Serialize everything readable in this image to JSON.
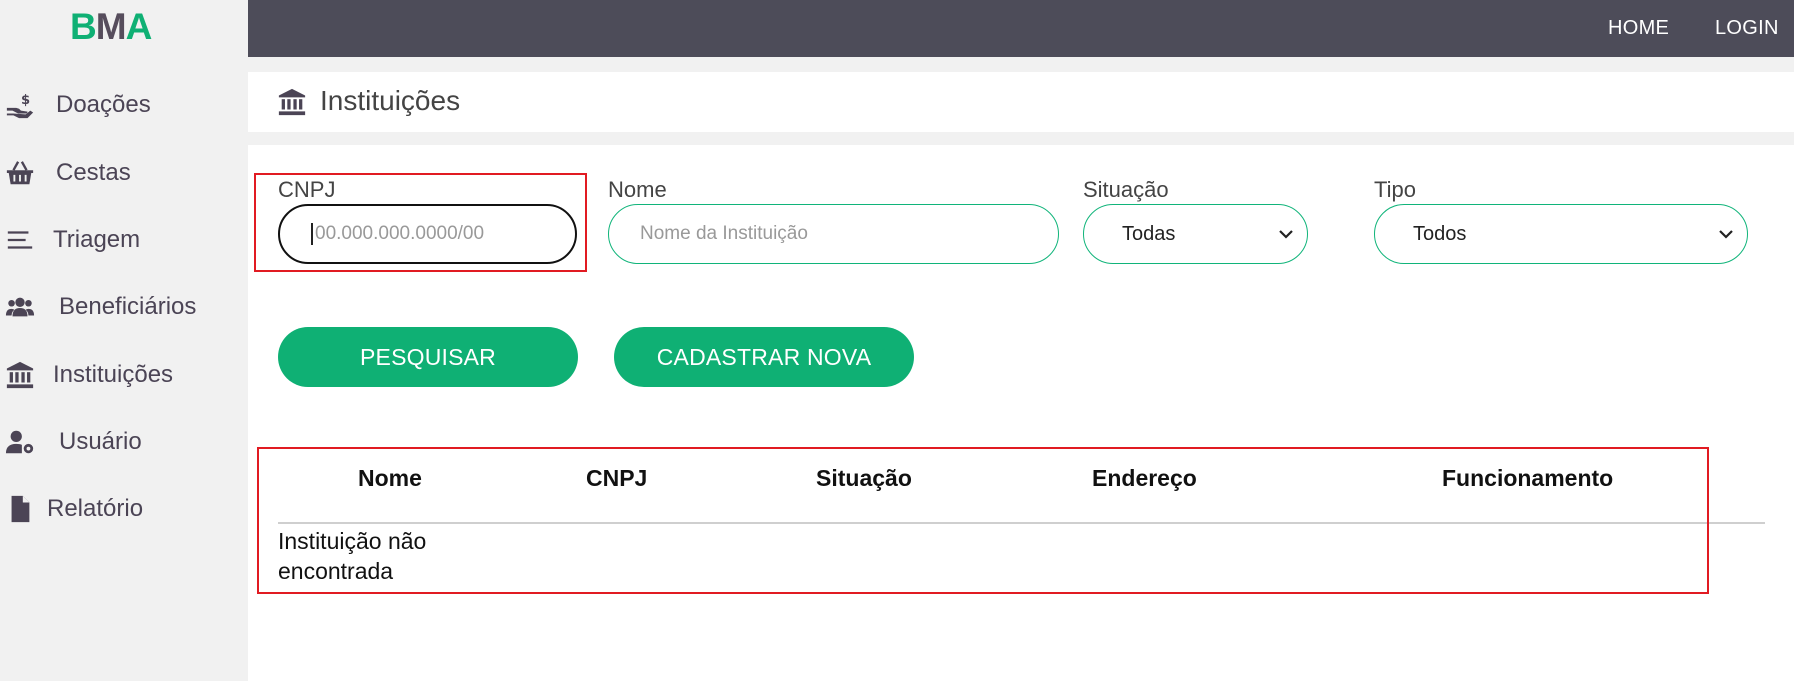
{
  "brand": {
    "letters": [
      "B",
      "M",
      "A"
    ],
    "colors": [
      "#0fb074",
      "#564d5c",
      "#0fb074"
    ]
  },
  "sidebar": {
    "items": [
      {
        "label": "Doações",
        "icon": "hand-dollar-icon"
      },
      {
        "label": "Cestas",
        "icon": "basket-icon"
      },
      {
        "label": "Triagem",
        "icon": "menu-lines-icon"
      },
      {
        "label": "Beneficiários",
        "icon": "users-icon"
      },
      {
        "label": "Instituições",
        "icon": "bank-icon"
      },
      {
        "label": "Usuário",
        "icon": "user-cog-icon"
      },
      {
        "label": "Relatório",
        "icon": "file-icon"
      }
    ]
  },
  "topbar": {
    "home": "HOME",
    "login": "LOGIN"
  },
  "page": {
    "title": "Instituições",
    "icon": "bank-icon"
  },
  "filters": {
    "cnpj": {
      "label": "CNPJ",
      "placeholder": "00.000.000.0000/00",
      "value": ""
    },
    "nome": {
      "label": "Nome",
      "placeholder": "Nome da Instituição",
      "value": ""
    },
    "situacao": {
      "label": "Situação",
      "selected": "Todas"
    },
    "tipo": {
      "label": "Tipo",
      "selected": "Todos"
    }
  },
  "actions": {
    "search": "PESQUISAR",
    "create": "CADASTRAR NOVA"
  },
  "table": {
    "columns": [
      "Nome",
      "CNPJ",
      "Situação",
      "Endereço",
      "Funcionamento"
    ],
    "empty_message": "Instituição não encontrada"
  },
  "colors": {
    "accent": "#0fb074",
    "topbar": "#4d4c59",
    "highlight": "#e11b22"
  }
}
